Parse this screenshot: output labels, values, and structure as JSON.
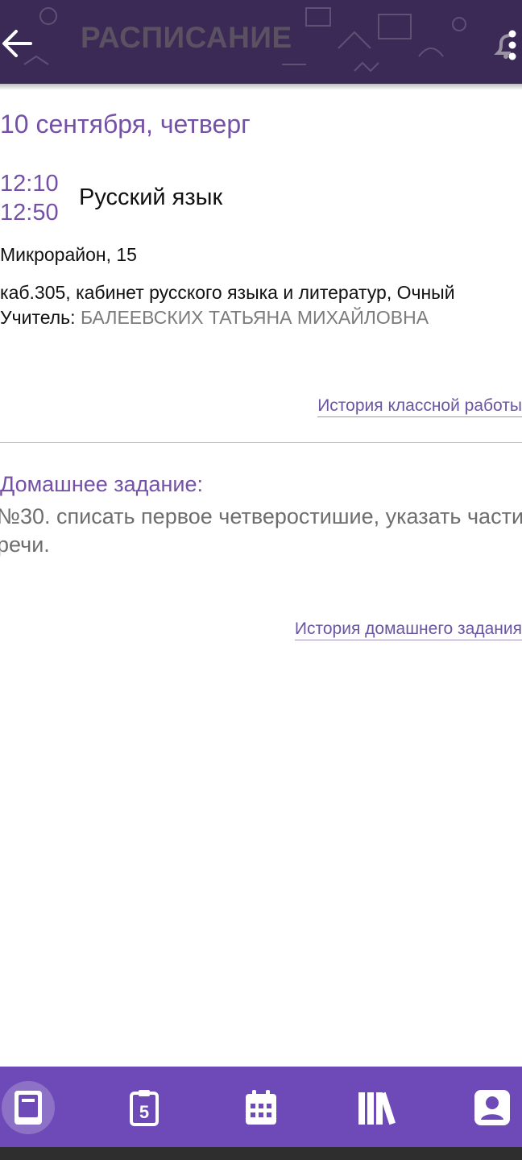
{
  "app_bar": {
    "title": "РАСПИСАНИЕ",
    "icons": [
      "arrow-left-icon",
      "bell-icon",
      "more-vert-icon"
    ]
  },
  "lesson": {
    "date": "10 сентября, четверг",
    "time_start": "12:10",
    "time_end": "12:50",
    "subject": "Русский язык",
    "address": "Микрорайон, 15",
    "room": "каб.305, кабинет русского языка и литератур, Очный",
    "teacher_label": "Учитель:",
    "teacher_name": "БАЛЕЕВСКИХ ТАТЬЯНА МИХАЙЛОВНА",
    "classwork_history_link": "История классной работы"
  },
  "homework": {
    "title": "Домашнее задание:",
    "text": "№30. списать первое четверостишие, указать части речи.",
    "history_link": "История домашнего задания"
  },
  "bottom_nav": {
    "items": [
      {
        "icon": "diary-icon",
        "active": true
      },
      {
        "icon": "grade-five-icon",
        "active": false
      },
      {
        "icon": "calendar-icon",
        "active": false
      },
      {
        "icon": "library-icon",
        "active": false
      },
      {
        "icon": "profile-icon",
        "active": false
      }
    ]
  },
  "colors": {
    "accent": "#7450a6",
    "appbar": "#3b2a55",
    "bottom_nav": "#6e4ab8",
    "link": "#6a55a0"
  }
}
